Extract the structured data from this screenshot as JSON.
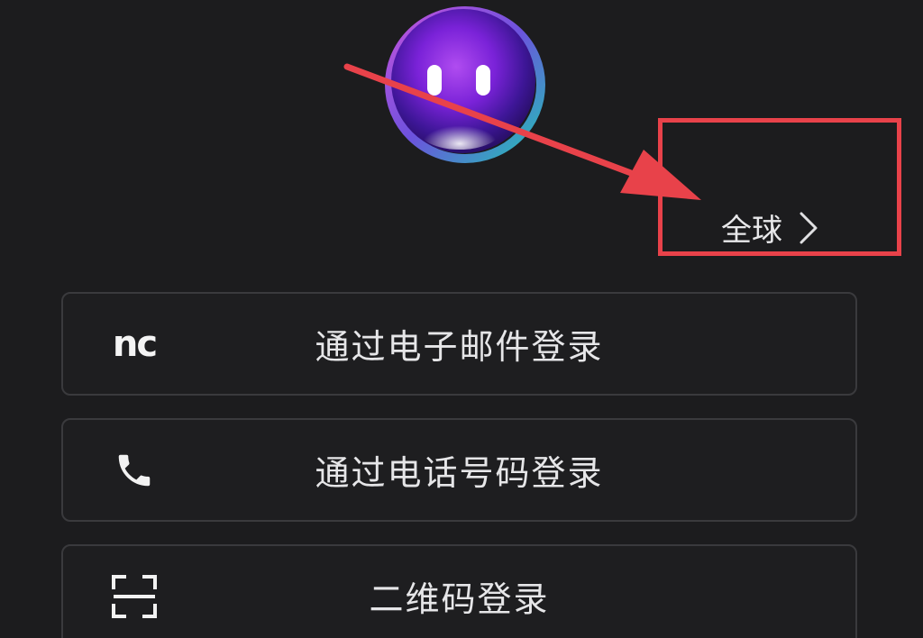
{
  "region": {
    "label": "全球",
    "chevron_icon": "chevron-right-icon"
  },
  "login_options": [
    {
      "label": "通过电子邮件登录",
      "icon": "nc-logo-icon",
      "icon_text": "nc"
    },
    {
      "label": "通过电话号码登录",
      "icon": "phone-icon"
    },
    {
      "label": "二维码登录",
      "icon": "qr-scan-icon"
    }
  ],
  "mascot": {
    "icon": "mascot-orb-icon"
  },
  "colors": {
    "background": "#1c1c1e",
    "button_border": "#3a3a3d",
    "text": "#e6e6e8",
    "annotation_red": "#e8424a"
  }
}
